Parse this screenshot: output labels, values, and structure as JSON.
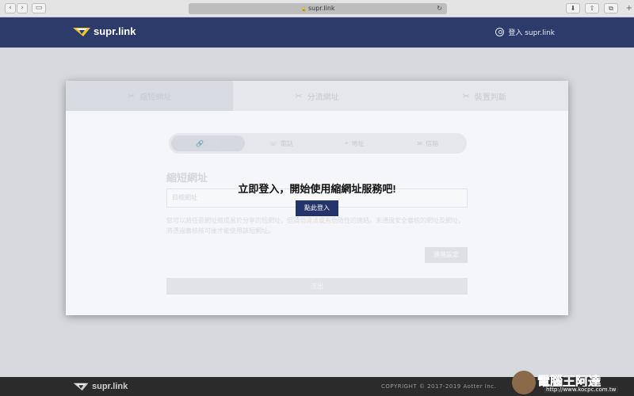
{
  "browser": {
    "url": "supr.link"
  },
  "header": {
    "brand": "supr.link",
    "login_label": "登入 supr.link"
  },
  "tabs": [
    {
      "label": "縮短網址"
    },
    {
      "label": "分流網址"
    },
    {
      "label": "裝置判斷"
    }
  ],
  "segments": [
    {
      "label": "網址"
    },
    {
      "label": "電話"
    },
    {
      "label": "地址"
    },
    {
      "label": "信箱"
    }
  ],
  "form": {
    "title": "縮短網址",
    "placeholder": "目標網址",
    "description": "您可以將任意網址縮成易於分享的短網址，但請勿違法或有危險性的連結。未通過安全審核的網址及網址，將透過審核核可後才能使用該短網址。",
    "advanced_label": "進階設定",
    "submit_label": "送出"
  },
  "overlay": {
    "message": "立即登入，開始使用縮網址服務吧!",
    "button_label": "點此登入"
  },
  "footer": {
    "brand": "supr.link",
    "copyright": "COPYRIGHT © 2017-2019 Aotter Inc."
  },
  "watermark": {
    "text": "電腦王阿達",
    "url": "http://www.kocpc.com.tw"
  },
  "colors": {
    "header_bg": "#2c3b6a",
    "accent": "#24346a",
    "logo_yellow": "#f2c230"
  }
}
